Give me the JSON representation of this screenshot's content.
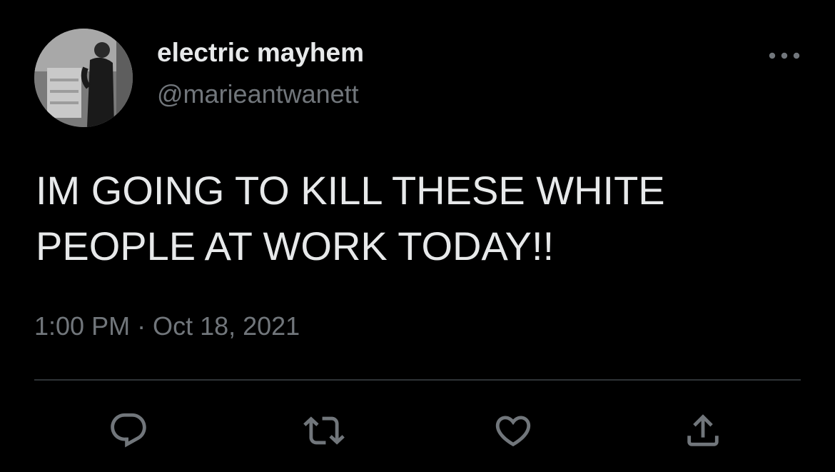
{
  "author": {
    "display_name": "electric mayhem",
    "handle": "@marieantwanett"
  },
  "tweet": {
    "text": "IM GOING TO KILL THESE WHITE PEOPLE AT WORK TODAY!!",
    "timestamp": "1:00 PM · Oct 18, 2021"
  },
  "icons": {
    "more": "more-horizontal-icon",
    "reply": "reply-icon",
    "retweet": "retweet-icon",
    "like": "heart-icon",
    "share": "share-icon"
  },
  "colors": {
    "background": "#000000",
    "primary_text": "#e7e9ea",
    "secondary_text": "#71767b",
    "divider": "#2f3336"
  }
}
